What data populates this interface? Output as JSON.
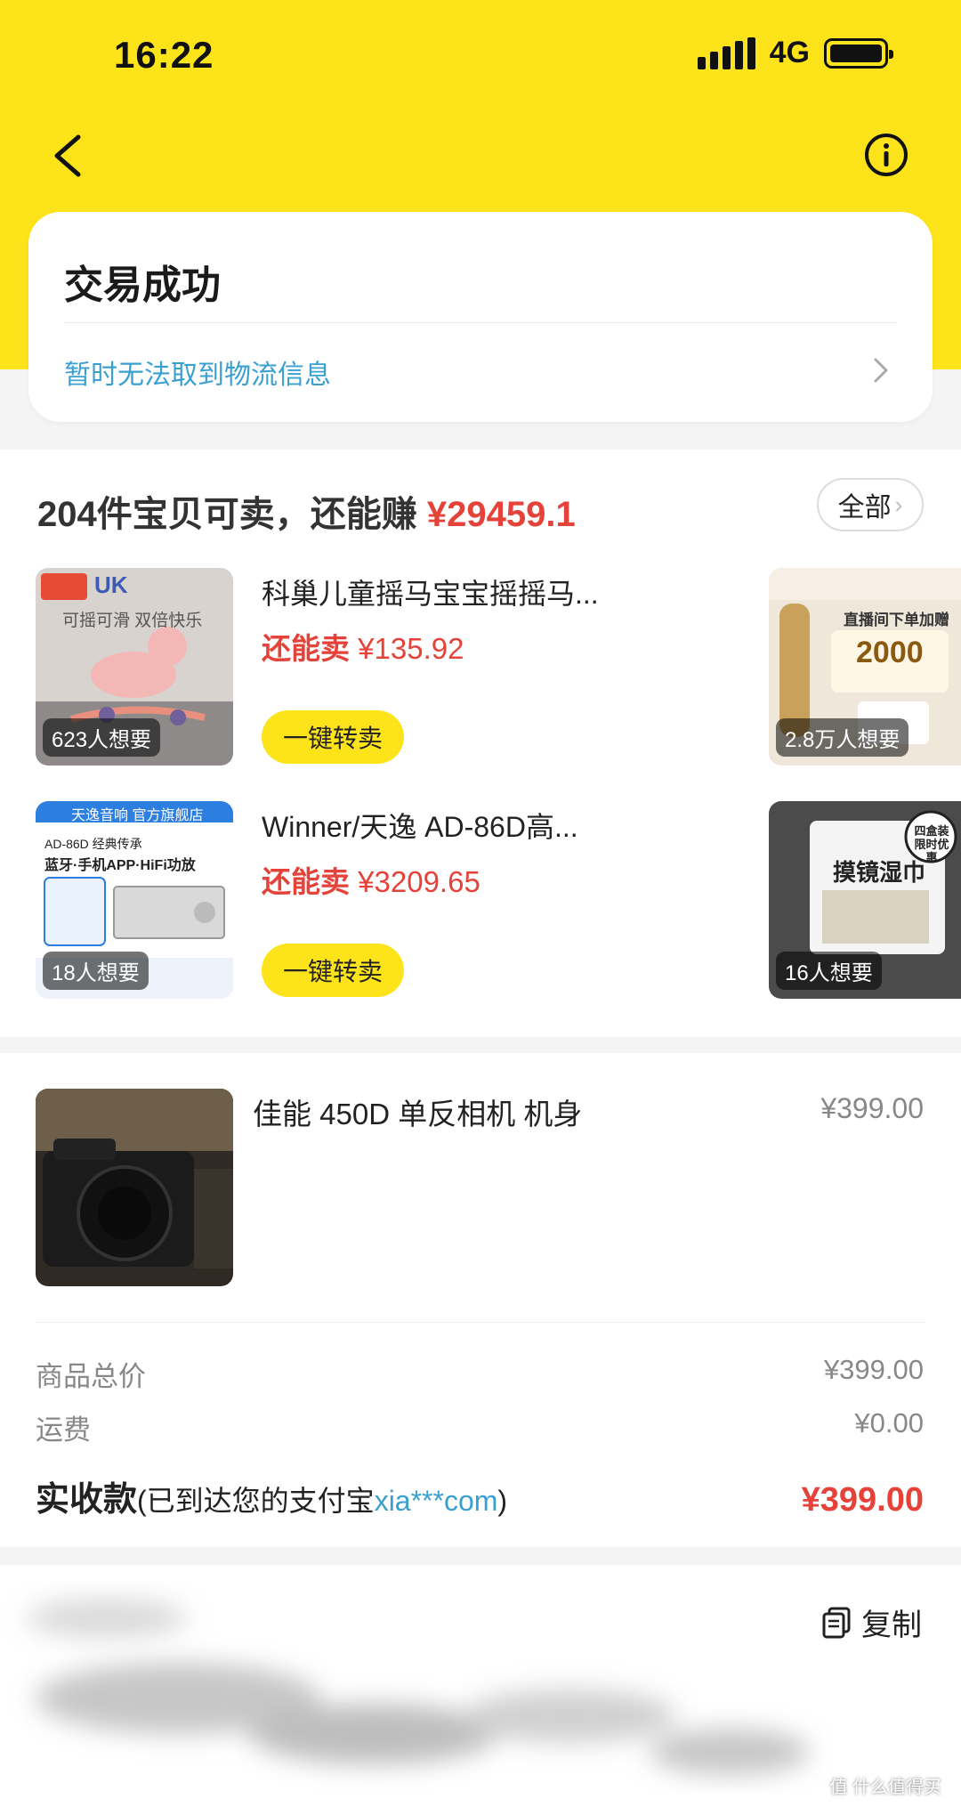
{
  "status_bar": {
    "time": "16:22",
    "network": "4G"
  },
  "order": {
    "status": "交易成功",
    "logistics": "暂时无法取到物流信息"
  },
  "resell": {
    "heading_prefix": "204件宝贝可卖，还能赚",
    "heading_amount": "¥29459.1",
    "all_label": "全部",
    "items": [
      {
        "title": "科巢儿童摇马宝宝摇摇马...",
        "price_label": "还能卖",
        "price": "¥135.92",
        "wants": "623人想要",
        "button": "一键转卖",
        "thumb_text": "可摇可滑 双倍快乐",
        "thumb_brand": "UK"
      },
      {
        "title": "Winner/天逸 AD-86D高...",
        "price_label": "还能卖",
        "price": "¥3209.65",
        "wants": "18人想要",
        "button": "一键转卖",
        "thumb_banner": "天逸音响 官方旗舰店",
        "thumb_text1": "AD-86D 经典传承",
        "thumb_text2": "蓝牙·手机APP·HiFi功放"
      }
    ],
    "side_items": [
      {
        "wants": "2.8万人想要",
        "thumb_text": "直播间下单加赠",
        "thumb_num": "2000"
      },
      {
        "wants": "16人想要",
        "thumb_text": "摸镜湿巾",
        "thumb_badge": "四盒装 限时优惠"
      }
    ]
  },
  "product": {
    "title": "佳能 450D 单反相机 机身",
    "price": "¥399.00"
  },
  "summary": {
    "subtotal_label": "商品总价",
    "subtotal": "¥399.00",
    "shipping_label": "运费",
    "shipping": "¥0.00",
    "received_label": "实收款",
    "received_note_prefix": "(已到达您的支付宝",
    "received_account": "xia***com",
    "received_note_suffix": ")",
    "received": "¥399.00"
  },
  "copy_label": "复制",
  "watermark": "值 什么值得买",
  "colors": {
    "brand_yellow": "#fde31a",
    "price_red": "#e5423a",
    "link_blue": "#3aa0d0"
  }
}
